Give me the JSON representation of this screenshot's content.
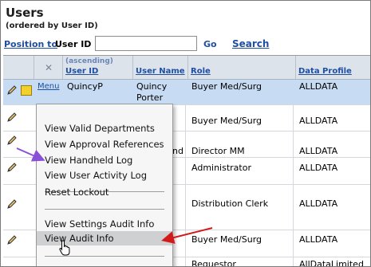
{
  "page": {
    "title": "Users",
    "subtitle": "(ordered by User ID)"
  },
  "position": {
    "link_label": "Position to",
    "field_label": "User ID",
    "input_value": "",
    "go_label": "Go",
    "search_label": "Search"
  },
  "table": {
    "sort_note": "(ascending)",
    "headers": {
      "user_id": "User ID",
      "user_name": "User Name",
      "role": "Role",
      "data_profile": "Data Profile"
    },
    "rows": [
      {
        "menu": "Menu",
        "user_id": "QuincyP",
        "user_name_1": "Quincy",
        "user_name_2": "Porter",
        "role": "Buyer Med/Surg",
        "data_profile": "ALLDATA"
      },
      {
        "role": "Buyer Med/Surg",
        "data_profile": "ALLDATA"
      },
      {
        "name_frag": "nd",
        "role": "Director MM",
        "data_profile": "ALLDATA"
      },
      {
        "role": "Administrator",
        "data_profile": "ALLDATA"
      },
      {
        "role": "Distribution Clerk",
        "data_profile": "ALLDATA"
      },
      {
        "role": "Buyer Med/Surg",
        "data_profile": "ALLDATA"
      },
      {
        "role": "Requestor",
        "data_profile": "AllDataLimited"
      }
    ]
  },
  "menu": {
    "items": [
      "View Valid Departments",
      "View Approval References",
      "View Handheld Log",
      "View User Activity Log",
      "Reset Lockout",
      "View Settings Audit Info",
      "View Audit Info"
    ],
    "hovered_item": "View Audit Info"
  },
  "colors": {
    "link": "#1f4fa3",
    "header_bg": "#dde3ea",
    "selected_row": "#c7dcf3",
    "menu_bg": "#f6f6f6",
    "menu_hover": "#cfd0d2",
    "annotation_purple": "#8a4fd6",
    "annotation_red": "#d21a1a"
  },
  "icons": [
    "edit-pencil-icon",
    "notes-icon",
    "clear-x-icon",
    "hand-pointer-cursor-icon"
  ]
}
